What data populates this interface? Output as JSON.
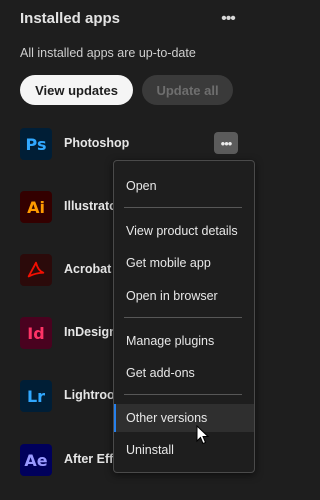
{
  "header": {
    "title": "Installed apps",
    "more_label": "•••"
  },
  "status": "All installed apps are up-to-date",
  "buttons": {
    "view_updates": "View updates",
    "update_all": "Update all"
  },
  "apps": [
    {
      "abbr": "Ps",
      "name": "Photoshop",
      "bg": "#001e36",
      "fg": "#31a8ff"
    },
    {
      "abbr": "Ai",
      "name": "Illustrator",
      "bg": "#330000",
      "fg": "#ff9a00"
    },
    {
      "abbr": "",
      "name": "Acrobat",
      "bg": "#2b0a0a",
      "fg": "#f40f02",
      "icon": "acrobat-icon"
    },
    {
      "abbr": "Id",
      "name": "InDesign",
      "bg": "#49021f",
      "fg": "#ff3366"
    },
    {
      "abbr": "Lr",
      "name": "Lightroom",
      "bg": "#001e36",
      "fg": "#31a8ff"
    },
    {
      "abbr": "Ae",
      "name": "After Effects",
      "bg": "#00005b",
      "fg": "#9999ff"
    }
  ],
  "row_more_label": "•••",
  "menu": {
    "items": [
      "Open",
      "View product details",
      "Get mobile app",
      "Open in browser",
      "Manage plugins",
      "Get add-ons",
      "Other versions",
      "Uninstall"
    ],
    "active_index": 6
  }
}
